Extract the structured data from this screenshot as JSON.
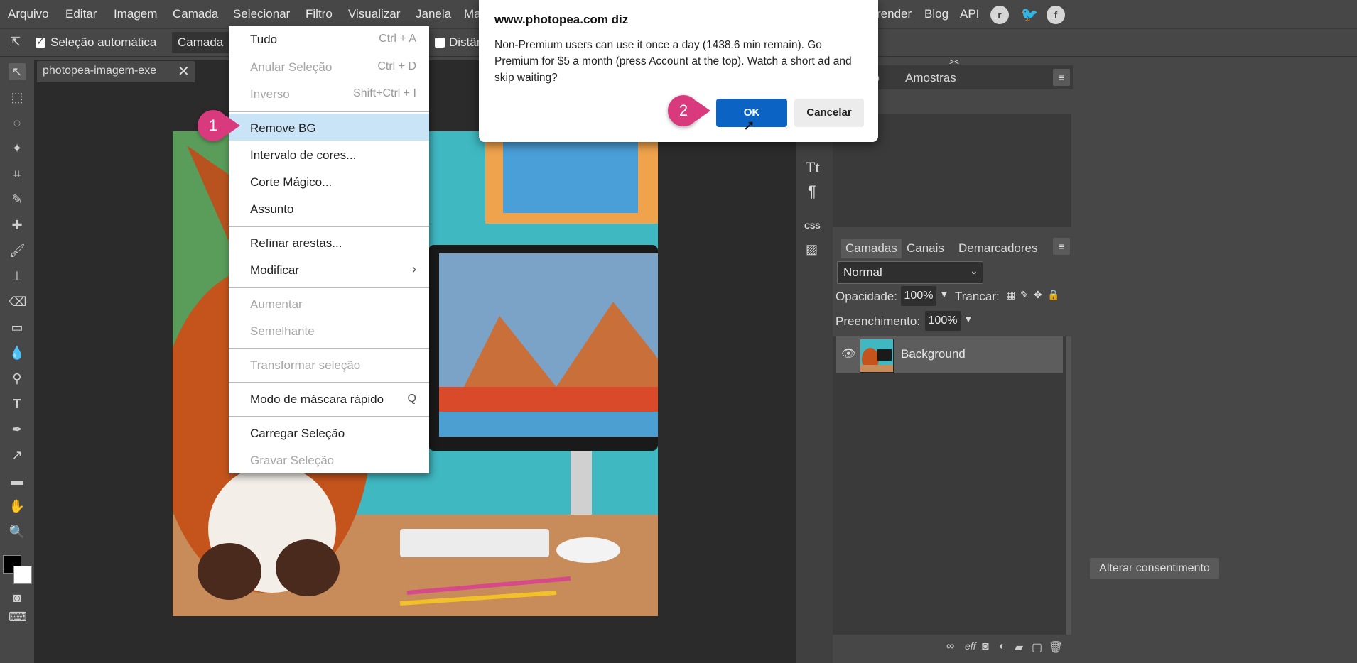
{
  "menubar": {
    "items": [
      "Arquivo",
      "Editar",
      "Imagem",
      "Camada",
      "Selecionar",
      "Filtro",
      "Visualizar",
      "Janela",
      "Ma"
    ],
    "right_items": [
      "render",
      "Blog",
      "API"
    ]
  },
  "optbar": {
    "auto_select_label": "Seleção automática",
    "layer_select": "Camada",
    "distances_label": "Distân"
  },
  "document": {
    "tab_title": "photopea-imagem-exe"
  },
  "dropdown": {
    "items": [
      {
        "label": "Tudo",
        "shortcut": "Ctrl + A",
        "disabled": false
      },
      {
        "label": "Anular Seleção",
        "shortcut": "Ctrl + D",
        "disabled": true
      },
      {
        "label": "Inverso",
        "shortcut": "Shift+Ctrl + I",
        "disabled": true
      },
      {
        "label": "Remove BG",
        "shortcut": "",
        "disabled": false
      },
      {
        "label": "Intervalo de cores...",
        "shortcut": "",
        "disabled": false
      },
      {
        "label": "Corte Mágico...",
        "shortcut": "",
        "disabled": false
      },
      {
        "label": "Assunto",
        "shortcut": "",
        "disabled": false
      },
      {
        "label": "Refinar arestas...",
        "shortcut": "",
        "disabled": false
      },
      {
        "label": "Modificar",
        "shortcut": "›",
        "disabled": false
      },
      {
        "label": "Aumentar",
        "shortcut": "",
        "disabled": true
      },
      {
        "label": "Semelhante",
        "shortcut": "",
        "disabled": true
      },
      {
        "label": "Transformar seleção",
        "shortcut": "",
        "disabled": true
      },
      {
        "label": "Modo de máscara rápido",
        "shortcut": "Q",
        "disabled": false
      },
      {
        "label": "Carregar Seleção",
        "shortcut": "",
        "disabled": false
      },
      {
        "label": "Gravar Seleção",
        "shortcut": "",
        "disabled": true
      }
    ]
  },
  "dialog": {
    "title": "www.photopea.com diz",
    "message": "Non-Premium users can use it once a day (1438.6 min remain). Go Premium for $5 a month (press Account at the top). Watch a short ad and skip waiting?",
    "ok_label": "OK",
    "cancel_label": "Cancelar"
  },
  "badges": [
    "1",
    "2"
  ],
  "panels": {
    "top_tabs": [
      "co",
      "Amostras"
    ],
    "collapse_glyph": "><",
    "layer_tabs": [
      "Camadas",
      "Canais",
      "Demarcadores"
    ],
    "blend_mode": "Normal",
    "opacity_label": "Opacidade:",
    "opacity_value": "100%",
    "lock_label": "Trancar:",
    "fill_label": "Preenchimento:",
    "fill_value": "100%",
    "layer_name": "Background",
    "footer_fx": "eff"
  },
  "right_strip": {
    "text_tool": "Tt",
    "paragraph": "¶",
    "css": "CSS"
  },
  "consent_label": "Alterar consentimento",
  "colors": {
    "accent_ok": "#0b63c4",
    "badge": "#d93a7d",
    "highlight": "#c9e3f7"
  }
}
